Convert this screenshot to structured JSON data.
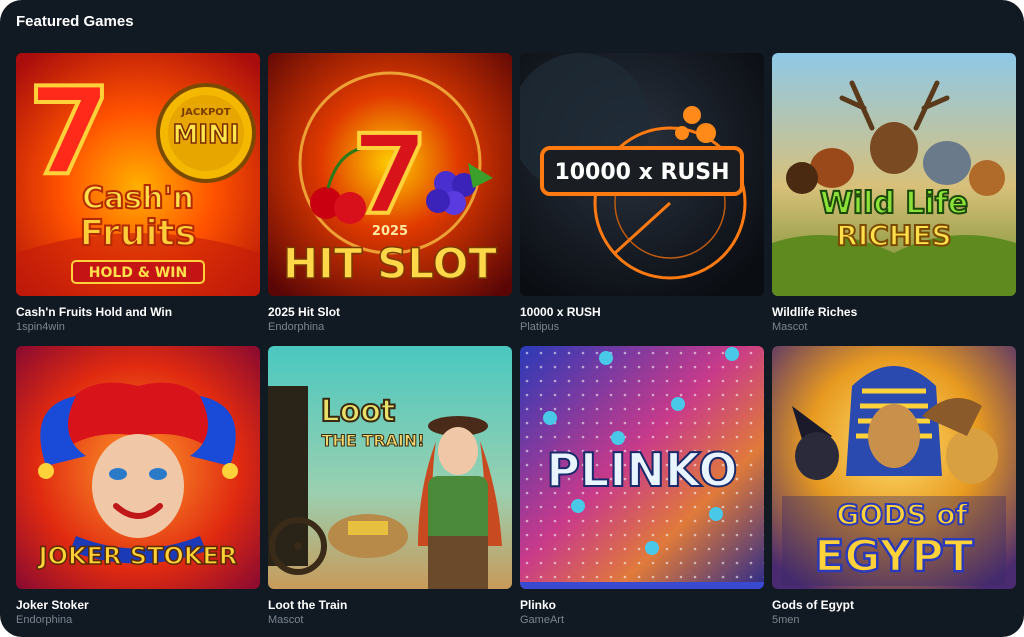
{
  "section": {
    "title": "Featured Games"
  },
  "games": [
    {
      "title": "Cash'n Fruits Hold and Win",
      "provider": "1spin4win",
      "art": {
        "line1": "Cash'n",
        "line2": "Fruits",
        "badge": "HOLD & WIN",
        "medal": "MINI",
        "medal_top": "JACKPOT",
        "big": "7"
      }
    },
    {
      "title": "2025 Hit Slot",
      "provider": "Endorphina",
      "art": {
        "year": "2025",
        "logo": "HIT SLOT",
        "big": "7"
      }
    },
    {
      "title": "10000 x RUSH",
      "provider": "Platipus",
      "art": {
        "logo": "10000 x RUSH"
      }
    },
    {
      "title": "Wildlife Riches",
      "provider": "Mascot",
      "art": {
        "line1": "Wild Life",
        "line2": "RICHES"
      }
    },
    {
      "title": "Joker Stoker",
      "provider": "Endorphina",
      "art": {
        "logo": "JOKER STOKER"
      }
    },
    {
      "title": "Loot the Train",
      "provider": "Mascot",
      "art": {
        "line1": "Loot",
        "line2": "THE TRAIN!"
      }
    },
    {
      "title": "Plinko",
      "provider": "GameArt",
      "art": {
        "logo": "PLINKO"
      }
    },
    {
      "title": "Gods of Egypt",
      "provider": "5men",
      "art": {
        "line1": "GODS of",
        "line2": "EGYPT"
      }
    }
  ]
}
